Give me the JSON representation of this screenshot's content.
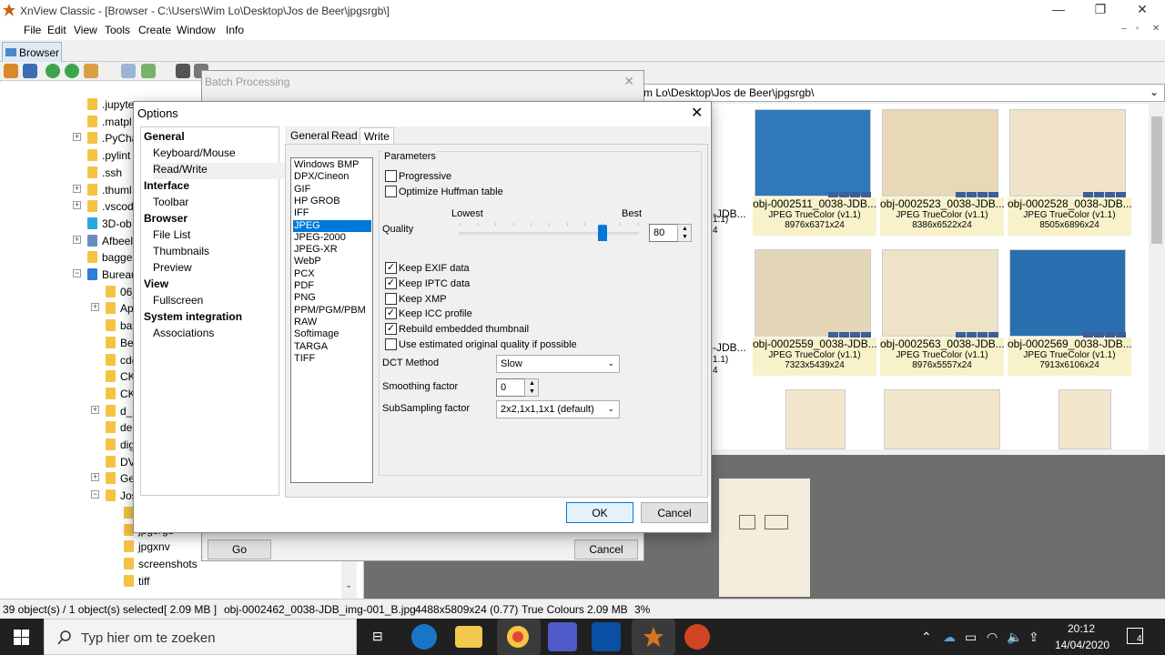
{
  "app": {
    "title": "XnView Classic - [Browser - C:\\Users\\Wim Lo\\Desktop\\Jos de Beer\\jpgsrgb\\]",
    "window_controls": [
      "—",
      "❐",
      "✕"
    ],
    "mdi_controls": [
      "–",
      "▫",
      "✕"
    ]
  },
  "menu": [
    "File",
    "Edit",
    "View",
    "Tools",
    "Create",
    "Window",
    "Info"
  ],
  "tab_label": "Browser",
  "tree": {
    "items": [
      ".jupyte",
      ".matpl",
      ".PyCha",
      ".pylint",
      ".ssh",
      ".thuml",
      ".vscod",
      "3D-ob",
      "Afbeel",
      "bagge",
      "Bureau",
      "06_",
      "Ap",
      "bat",
      "Bez",
      "cd(",
      "CK",
      "CK",
      "d_2",
      "del",
      "dig",
      "DV",
      "Ge",
      "Jos",
      "",
      "jpgsrgb",
      "jpgxnv",
      "screenshots",
      "tiff"
    ]
  },
  "path_value": "m Lo\\Desktop\\Jos de Beer\\jpgsrgb\\",
  "thumbnails": [
    {
      "name": "obj-0002511_0038-JDB...",
      "type": "JPEG TrueColor (v1.1)",
      "size": "8976x6371x24",
      "color": "#2f79b8"
    },
    {
      "name": "obj-0002523_0038-JDB...",
      "type": "JPEG TrueColor (v1.1)",
      "size": "8386x6522x24",
      "color": "#e8d8b8"
    },
    {
      "name": "obj-0002528_0038-JDB...",
      "type": "JPEG TrueColor (v1.1)",
      "size": "8505x6896x24",
      "color": "#f0e2c8"
    },
    {
      "name": "obj-0002559_0038-JDB...",
      "type": "JPEG TrueColor (v1.1)",
      "size": "7323x5439x24",
      "color": "#e3d6b8"
    },
    {
      "name": "obj-0002563_0038-JDB...",
      "type": "JPEG TrueColor (v1.1)",
      "size": "8976x5557x24",
      "color": "#efe3c7"
    },
    {
      "name": "obj-0002569_0038-JDB...",
      "type": "JPEG TrueColor (v1.1)",
      "size": "7913x6106x24",
      "color": "#2a6fb0"
    }
  ],
  "partial_left": {
    "row1a": "1.1)",
    "row1b": "4",
    "row2a": "-JDB...",
    "row2b": "1.1)",
    "row2c": "4",
    "row0": "-JDB..."
  },
  "status": {
    "objects": "39 object(s) / 1 object(s) selected",
    "size": "[ 2.09 MB ]",
    "filename": "obj-0002462_0038-JDB_img-001_B.jpg",
    "dims": "4488x5809x24 (0.77)",
    "colors": "True Colours",
    "mb": "2.09 MB",
    "zoom": "3%"
  },
  "batch": {
    "title": "Batch Processing",
    "go": "Go",
    "cancel": "Cancel"
  },
  "options": {
    "title": "Options",
    "categories": [
      {
        "label": "General",
        "header": true
      },
      {
        "label": "Keyboard/Mouse",
        "header": false
      },
      {
        "label": "Read/Write",
        "header": false,
        "selected": true
      },
      {
        "label": "Interface",
        "header": true
      },
      {
        "label": "Toolbar",
        "header": false
      },
      {
        "label": "Browser",
        "header": true
      },
      {
        "label": "File List",
        "header": false
      },
      {
        "label": "Thumbnails",
        "header": false
      },
      {
        "label": "Preview",
        "header": false
      },
      {
        "label": "View",
        "header": true
      },
      {
        "label": "Fullscreen",
        "header": false
      },
      {
        "label": "System integration",
        "header": true
      },
      {
        "label": "Associations",
        "header": false
      }
    ],
    "tabs": [
      "General",
      "Read",
      "Write"
    ],
    "active_tab": "Write",
    "formats": [
      "Windows BMP",
      "DPX/Cineon",
      "GIF",
      "HP GROB",
      "IFF",
      "JPEG",
      "JPEG-2000",
      "JPEG-XR",
      "WebP",
      "PCX",
      "PDF",
      "PNG",
      "PPM/PGM/PBM",
      "RAW",
      "Softimage",
      "TARGA",
      "TIFF"
    ],
    "selected_format": "JPEG",
    "params": {
      "group_label": "Parameters",
      "progressive": "Progressive",
      "optimize": "Optimize Huffman table",
      "quality_label": "Quality",
      "lowest": "Lowest",
      "best": "Best",
      "quality_value": "80",
      "quality_level": 80,
      "keep_exif": "Keep EXIF data",
      "keep_iptc": "Keep IPTC data",
      "keep_xmp": "Keep XMP",
      "keep_icc": "Keep ICC profile",
      "rebuild": "Rebuild embedded thumbnail",
      "estimated": "Use estimated original quality if possible",
      "dct_label": "DCT Method",
      "dct_value": "Slow",
      "smoothing_label": "Smoothing factor",
      "smoothing_value": "0",
      "subsampling_label": "SubSampling factor",
      "subsampling_value": "2x2,1x1,1x1 (default)",
      "checks": {
        "progressive": false,
        "optimize": false,
        "keep_exif": true,
        "keep_iptc": true,
        "keep_xmp": false,
        "keep_icc": true,
        "rebuild": true,
        "estimated": false
      }
    },
    "ok": "OK",
    "cancel": "Cancel"
  },
  "taskbar": {
    "search_placeholder": "Typ hier om te zoeken",
    "time": "20:12",
    "date": "14/04/2020",
    "notif_count": "4"
  }
}
